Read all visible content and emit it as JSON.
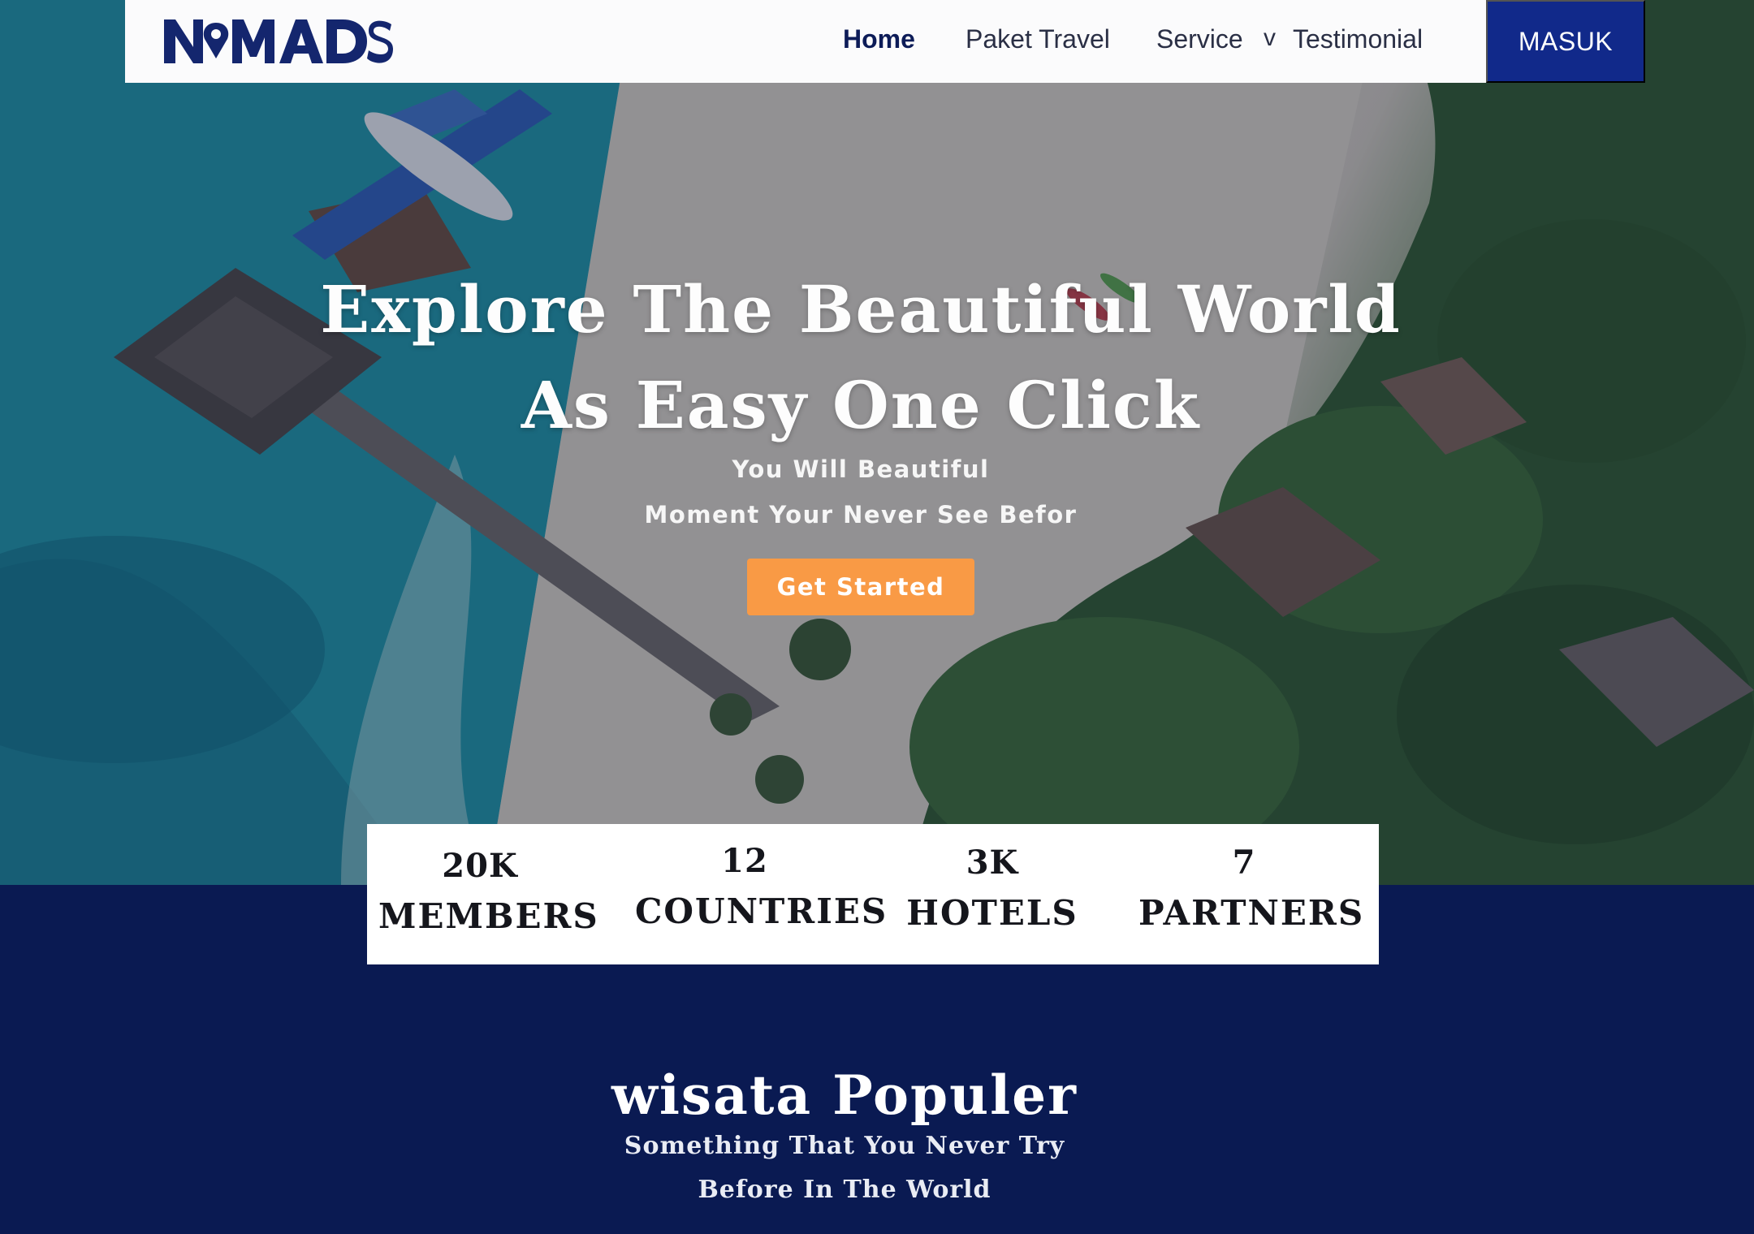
{
  "brand": {
    "logo_text": "NOMADS"
  },
  "nav": {
    "links": [
      {
        "label": "Home",
        "active": true
      },
      {
        "label": "Paket Travel",
        "active": false
      },
      {
        "label": "Service",
        "active": false
      },
      {
        "label": "Testimonial",
        "active": false
      }
    ],
    "dropdown_chevron": "v",
    "login_label": "MASUK"
  },
  "hero": {
    "title_line1": "Explore The Beautiful World",
    "title_line2": "As Easy One Click",
    "subtitle_line1": "You Will Beautiful",
    "subtitle_line2": "Moment Your Never See Befor",
    "cta_label": "Get Started"
  },
  "stats": [
    {
      "value": "20K",
      "label": "MEMBERS"
    },
    {
      "value": "12",
      "label": "COUNTRIES"
    },
    {
      "value": "3K",
      "label": "HOTELS"
    },
    {
      "value": "7",
      "label": "PARTNERS"
    }
  ],
  "popular": {
    "title": "wisata Populer",
    "subtitle_line1": "Something That You Never Try",
    "subtitle_line2": "Before In The World"
  },
  "colors": {
    "nav_bg": "#fbfbfc",
    "login_bg": "#11298a",
    "cta_bg": "#f99a45",
    "section_bg": "#0a1a52",
    "brand_navy": "#14266e"
  }
}
